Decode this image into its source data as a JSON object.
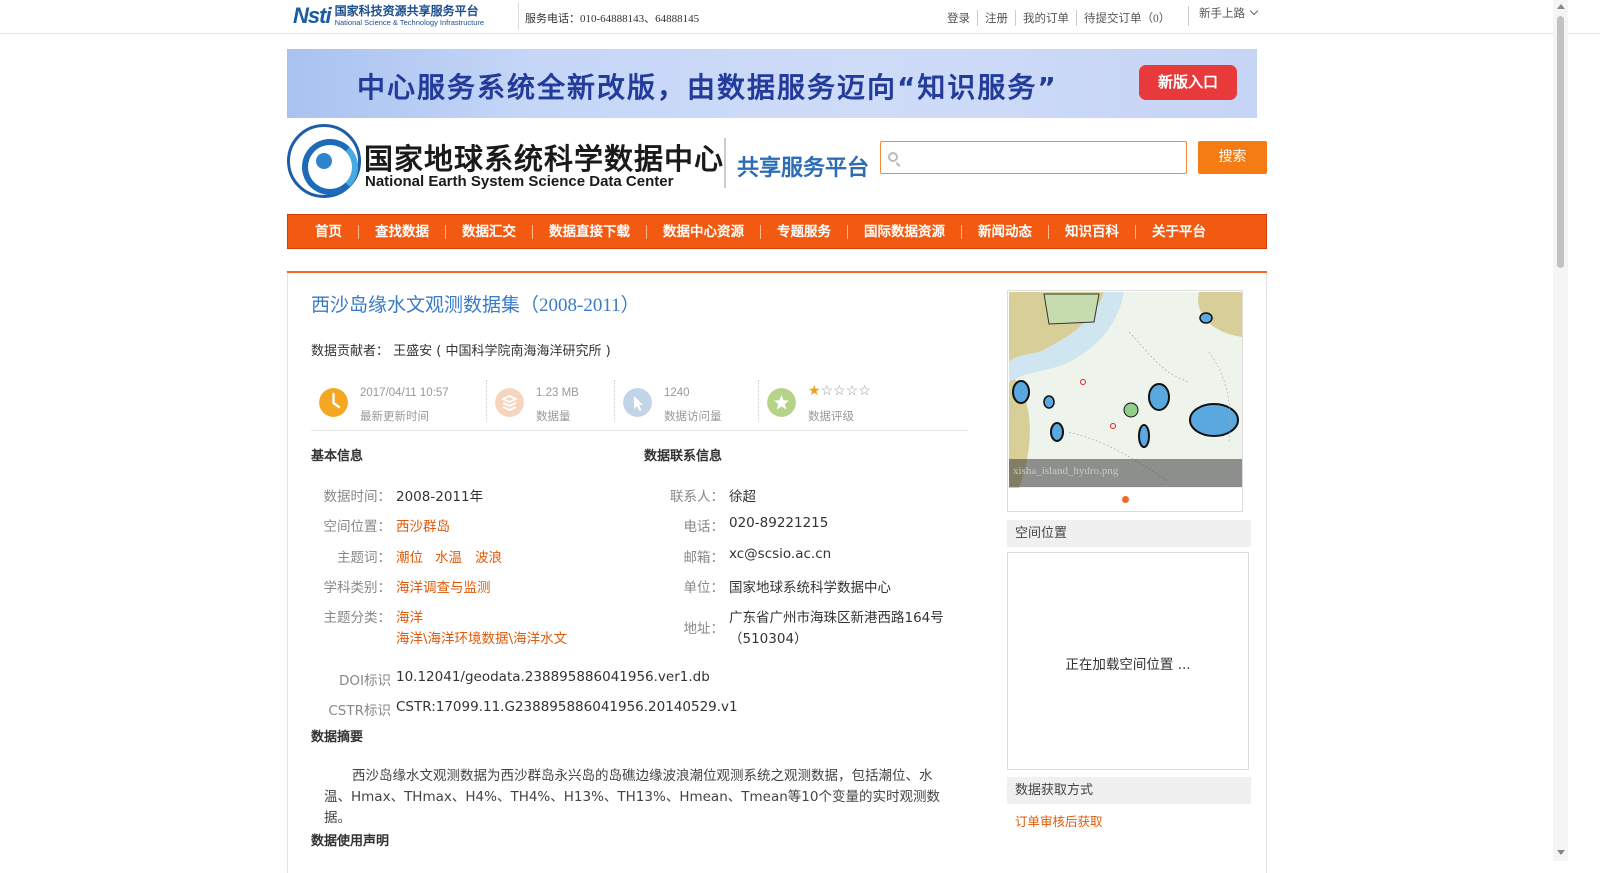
{
  "topbar": {
    "brand_cn": "国家科技资源共享服务平台",
    "brand_en": "National Science & Technology Infrastructure",
    "brand_mark": "Nsti",
    "phone": "服务电话：010-64888143、64888145",
    "links": [
      "登录",
      "注册",
      "我的订单",
      "待提交订单（0）"
    ],
    "newbie": "新手上路"
  },
  "banner": {
    "text": "中心服务系统全新改版，由数据服务迈向“知识服务”",
    "button": "新版入口"
  },
  "header": {
    "center_cn": "国家地球系统科学数据中心",
    "center_en": "National Earth System Science Data Center",
    "platform": "共享服务平台",
    "search_placeholder": "",
    "search_button": "搜索"
  },
  "nav": [
    "首页",
    "查找数据",
    "数据汇交",
    "数据直接下载",
    "数据中心资源",
    "专题服务",
    "国际数据资源",
    "新闻动态",
    "知识百科",
    "关于平台"
  ],
  "dataset": {
    "title": "西沙岛缘水文观测数据集（2008-2011）",
    "contributor": "数据贡献者： 王盛安 ( 中国科学院南海海洋研究所 )",
    "stats": {
      "updated": "2017/04/11 10:57",
      "updated_label": "最新更新时间",
      "size": "1.23 MB",
      "size_label": "数据量",
      "visits": "1240",
      "visits_label": "数据访问量",
      "rating": 1,
      "rating_max": 5,
      "rating_label": "数据评级"
    },
    "basic_header": "基本信息",
    "contact_header": "数据联系信息",
    "basic": {
      "time_key": "数据时间：",
      "time_val": "2008-2011年",
      "space_key": "空间位置：",
      "space_val": "西沙群岛",
      "theme_key": "主题词：",
      "themes": [
        "潮位",
        "水温",
        "波浪"
      ],
      "subject_key": "学科类别：",
      "subject_val": "海洋调查与监测",
      "category_key": "主题分类：",
      "category_val1": "海洋",
      "category_val2": "海洋\\海洋环境数据\\海洋水文",
      "doi_key": "DOI标识",
      "doi_val": "10.12041/geodata.238895886041956.ver1.db",
      "cstr_key": "CSTR标识",
      "cstr_val": "CSTR:17099.11.G238895886041956.20140529.v1"
    },
    "contact": {
      "person_key": "联系人：",
      "person_val": "徐超",
      "phone_key": "电话：",
      "phone_val": "020-89221215",
      "email_key": "邮箱：",
      "email_val": "xc@scsio.ac.cn",
      "org_key": "单位：",
      "org_val": "国家地球系统科学数据中心",
      "addr_key": "地址：",
      "addr_val1": "广东省广州市海珠区新港西路164号",
      "addr_val2": "（510304）"
    },
    "abstract_header": "数据摘要",
    "abstract": "西沙岛缘水文观测数据为西沙群岛永兴岛的岛礁边缘波浪潮位观测系统之观测数据，包括潮位、水温、Hmax、THmax、H4%、TH4%、H13%、TH13%、Hmean、Tmean等10个变量的实时观测数据。",
    "usage_header": "数据使用声明"
  },
  "sidebar": {
    "thumb_caption": "xisha_island_hydro.png",
    "spatial_header": "空间位置",
    "spatial_loading": "正在加载空间位置 ...",
    "access_header": "数据获取方式",
    "access_link": "订单审核后获取"
  },
  "colors": {
    "accent": "#f25a12",
    "link": "#e15a0a",
    "title_blue": "#3a7bc8"
  }
}
